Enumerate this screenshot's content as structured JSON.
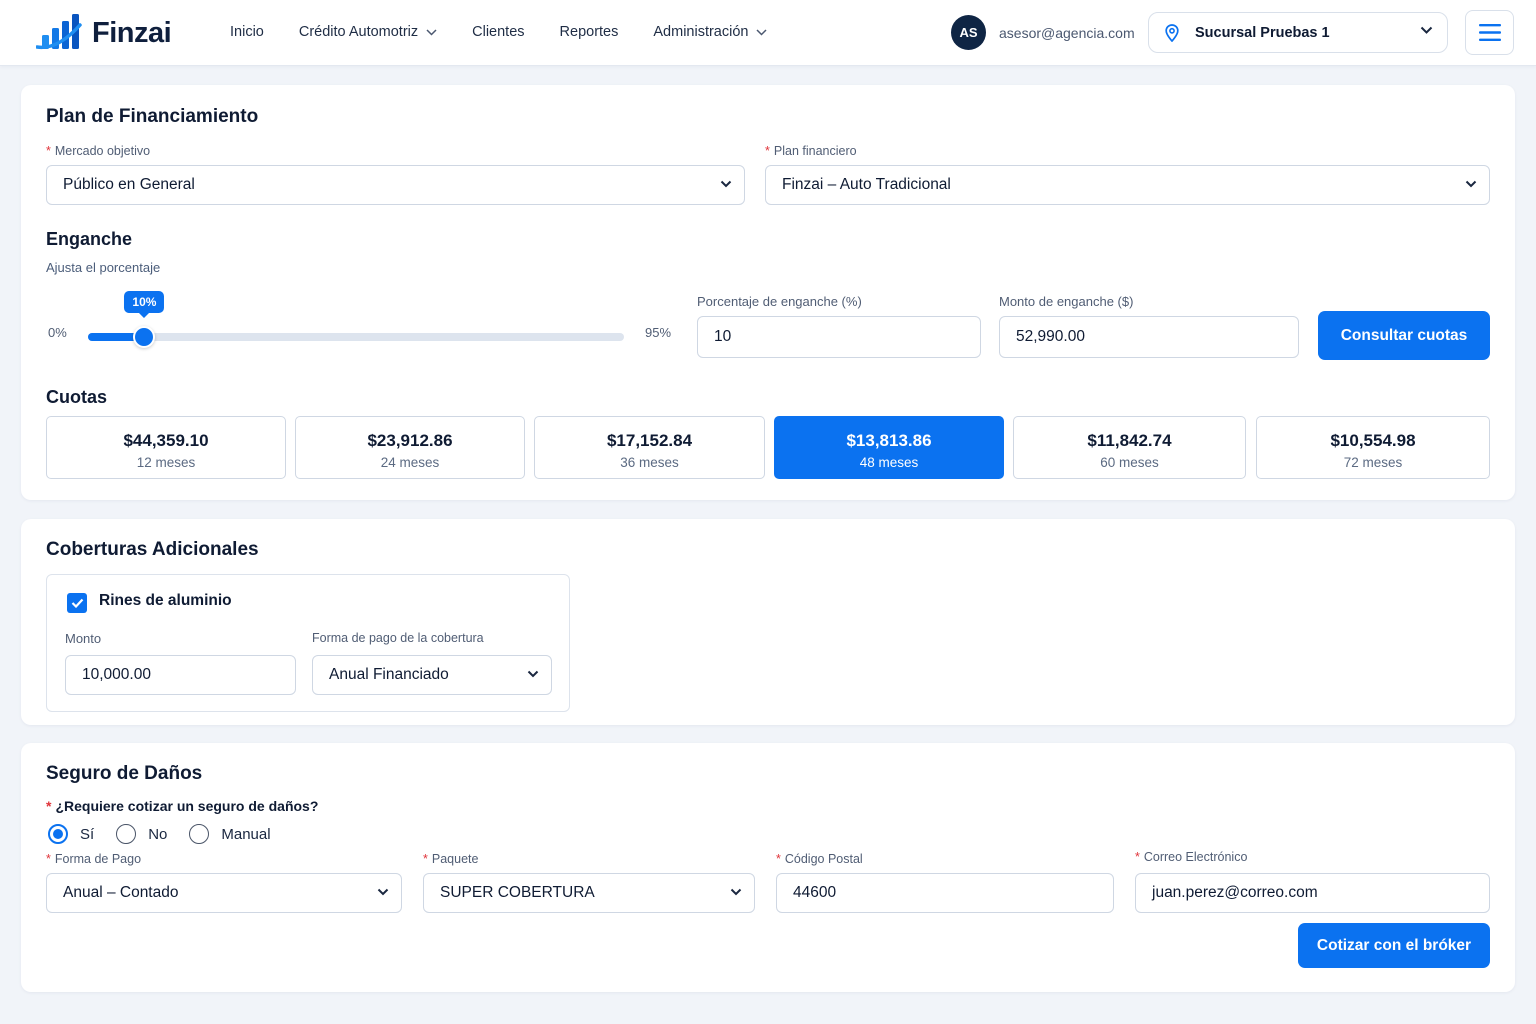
{
  "brand": {
    "name": "Finzai",
    "accent": "#0b72f0",
    "dark": "#0f2544"
  },
  "nav": {
    "items": [
      {
        "label": "Inicio",
        "dropdown": false
      },
      {
        "label": "Crédito Automotriz",
        "dropdown": true
      },
      {
        "label": "Clientes",
        "dropdown": false
      },
      {
        "label": "Reportes",
        "dropdown": false
      },
      {
        "label": "Administración",
        "dropdown": true
      }
    ]
  },
  "user": {
    "initials": "AS",
    "email": "asesor@agencia.com"
  },
  "branch": {
    "label": "Sucursal Pruebas 1",
    "icon": "location-pin-icon"
  },
  "plan": {
    "title": "Plan de Financiamiento",
    "market_label": "Mercado objetivo",
    "market_value": "Público en General",
    "plan_label": "Plan financiero",
    "plan_value": "Finzai – Auto Tradicional"
  },
  "downpayment": {
    "title": "Enganche",
    "subtitle": "Ajusta el porcentaje",
    "slider_min_label": "0%",
    "slider_max_label": "95%",
    "slider_min": 0,
    "slider_max": 95,
    "slider_value": 10,
    "slider_tooltip": "10%",
    "percent_label": "Porcentaje de enganche (%)",
    "percent_value": "10",
    "amount_label": "Monto de enganche ($)",
    "amount_value": "52,990.00",
    "button_label": "Consultar cuotas"
  },
  "cuotas": {
    "title": "Cuotas",
    "items": [
      {
        "amount": "$44,359.10",
        "term": "12 meses",
        "selected": false
      },
      {
        "amount": "$23,912.86",
        "term": "24 meses",
        "selected": false
      },
      {
        "amount": "$17,152.84",
        "term": "36 meses",
        "selected": false
      },
      {
        "amount": "$13,813.86",
        "term": "48 meses",
        "selected": true
      },
      {
        "amount": "$11,842.74",
        "term": "60 meses",
        "selected": false
      },
      {
        "amount": "$10,554.98",
        "term": "72 meses",
        "selected": false
      }
    ]
  },
  "coberturas": {
    "title": "Coberturas Adicionales",
    "item_label": "Rines de aluminio",
    "checked": true,
    "monto_label": "Monto",
    "monto_value": "10,000.00",
    "pago_label": "Forma de pago de la cobertura",
    "pago_value": "Anual Financiado"
  },
  "seguro": {
    "title": "Seguro de Daños",
    "question": "¿Requiere cotizar un seguro de daños?",
    "options": [
      "Sí",
      "No",
      "Manual"
    ],
    "selected_option": "Sí",
    "forma_label": "Forma de Pago",
    "forma_value": "Anual – Contado",
    "paquete_label": "Paquete",
    "paquete_value": "SUPER COBERTURA",
    "cp_label": "Código Postal",
    "cp_value": "44600",
    "email_label": "Correo Electrónico",
    "email_value": "juan.perez@correo.com",
    "button_label": "Cotizar con el bróker"
  }
}
